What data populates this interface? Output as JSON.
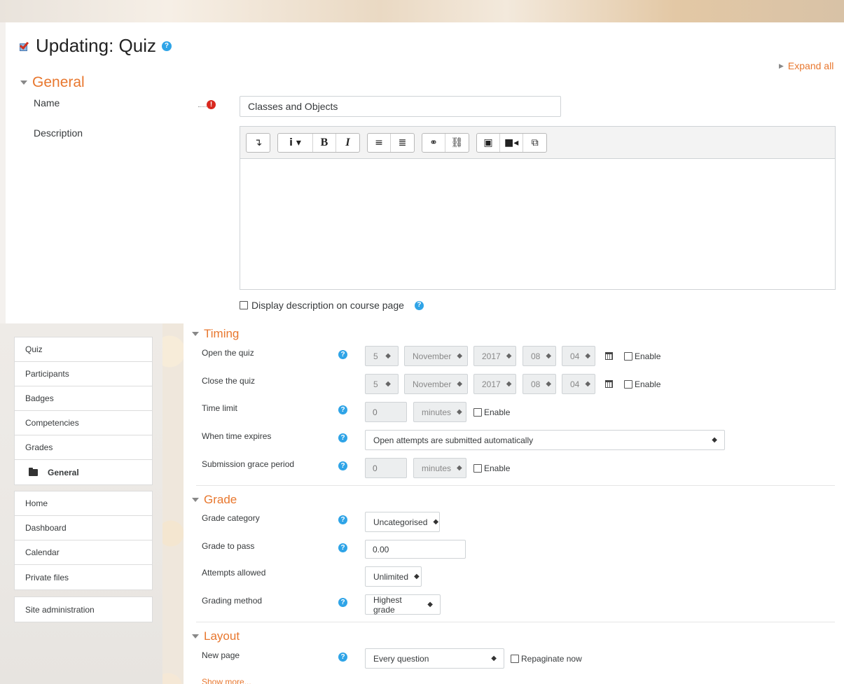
{
  "page": {
    "title": "Updating: Quiz",
    "expand_all": "Expand all"
  },
  "sections": {
    "general": "General",
    "timing": "Timing",
    "grade": "Grade",
    "layout": "Layout"
  },
  "general": {
    "name_label": "Name",
    "name_value": "Classes and Objects",
    "description_label": "Description",
    "display_description": "Display description on course page"
  },
  "editor": {
    "toolbar": [
      "↴",
      "i ▾",
      "B",
      "I",
      "≡",
      "≣",
      "⚭",
      "⛓",
      "▣",
      "■◂",
      "⧉"
    ]
  },
  "timing": {
    "open_label": "Open the quiz",
    "close_label": "Close the quiz",
    "date": {
      "day": "5",
      "month": "November",
      "year": "2017",
      "hour": "08",
      "minute": "04"
    },
    "enable": "Enable",
    "time_limit_label": "Time limit",
    "time_limit_value": "0",
    "unit": "minutes",
    "expires_label": "When time expires",
    "expires_value": "Open attempts are submitted automatically",
    "grace_label": "Submission grace period",
    "grace_value": "0"
  },
  "grade": {
    "category_label": "Grade category",
    "category_value": "Uncategorised",
    "pass_label": "Grade to pass",
    "pass_value": "0.00",
    "attempts_label": "Attempts allowed",
    "attempts_value": "Unlimited",
    "method_label": "Grading method",
    "method_value": "Highest grade"
  },
  "layout": {
    "new_page_label": "New page",
    "new_page_value": "Every question",
    "repaginate": "Repaginate now",
    "show_more": "Show more..."
  },
  "sidebar": {
    "course": [
      "Quiz",
      "Participants",
      "Badges",
      "Competencies",
      "Grades",
      "General"
    ],
    "site": [
      "Home",
      "Dashboard",
      "Calendar",
      "Private files"
    ],
    "admin": "Site administration"
  },
  "colors": {
    "accent": "#e8772e",
    "help": "#2fa4e7",
    "required": "#d9281f"
  }
}
